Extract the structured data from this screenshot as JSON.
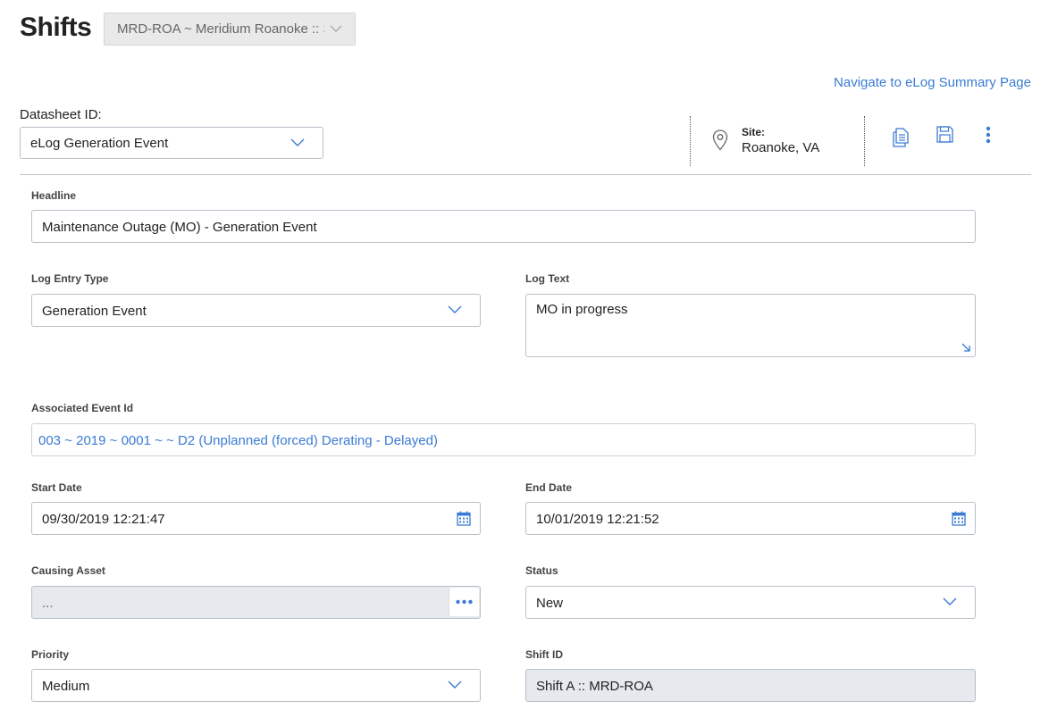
{
  "header": {
    "title": "Shifts",
    "site_selector_value": "MRD-ROA ~ Meridium Roanoke :: S",
    "nav_link": "Navigate to eLog Summary Page"
  },
  "datasheet": {
    "label": "Datasheet ID:",
    "value": "eLog Generation Event"
  },
  "site": {
    "label": "Site:",
    "value": "Roanoke, VA"
  },
  "toolbar_icons": [
    "copy-document-icon",
    "save-icon",
    "more-vertical-icon"
  ],
  "form": {
    "headline": {
      "label": "Headline",
      "value": "Maintenance Outage (MO) - Generation Event"
    },
    "log_entry_type": {
      "label": "Log Entry Type",
      "value": "Generation Event"
    },
    "log_text": {
      "label": "Log Text",
      "value": "MO in progress"
    },
    "associated_event_id": {
      "label": "Associated Event Id",
      "value": "003 ~ 2019 ~ 0001 ~ ~ D2 (Unplanned (forced) Derating - Delayed)"
    },
    "start_date": {
      "label": "Start Date",
      "value": "09/30/2019 12:21:47"
    },
    "end_date": {
      "label": "End Date",
      "value": "10/01/2019 12:21:52"
    },
    "causing_asset": {
      "label": "Causing Asset",
      "value": "..."
    },
    "status": {
      "label": "Status",
      "value": "New"
    },
    "priority": {
      "label": "Priority",
      "value": "Medium"
    },
    "shift_id": {
      "label": "Shift ID",
      "value": "Shift A :: MRD-ROA"
    }
  },
  "colors": {
    "link": "#3b7bd4",
    "icon": "#3b7bd4",
    "readonly_bg": "#e6e9ee"
  }
}
